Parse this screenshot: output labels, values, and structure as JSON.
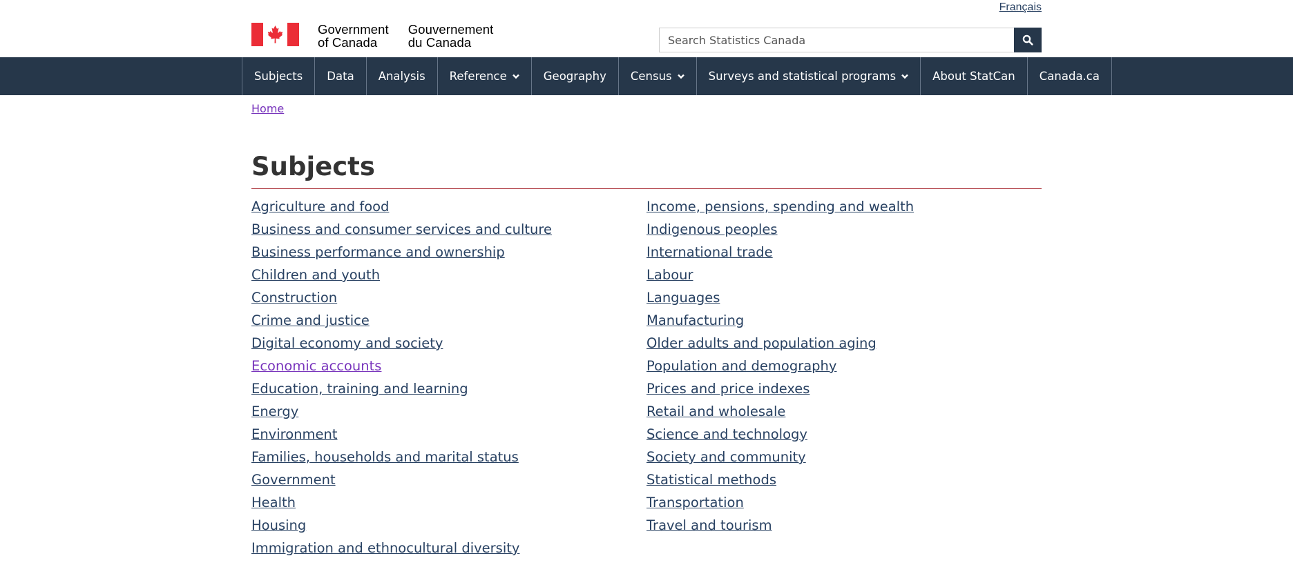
{
  "header": {
    "language_toggle": "Français",
    "signature_en_line1": "Government",
    "signature_en_line2": "of Canada",
    "signature_fr_line1": "Gouvernement",
    "signature_fr_line2": "du Canada",
    "search_placeholder": "Search Statistics Canada",
    "search_icon": "search-icon"
  },
  "nav": {
    "items": [
      {
        "label": "Subjects"
      },
      {
        "label": "Data"
      },
      {
        "label": "Analysis"
      },
      {
        "label": "Reference",
        "dropdown": true
      },
      {
        "label": "Geography"
      },
      {
        "label": "Census",
        "dropdown": true
      },
      {
        "label": "Surveys and statistical programs",
        "dropdown": true
      },
      {
        "label": "About StatCan"
      },
      {
        "label": "Canada.ca"
      }
    ]
  },
  "breadcrumb": {
    "home": "Home"
  },
  "main": {
    "title": "Subjects",
    "left_column": [
      "Agriculture and food",
      "Business and consumer services and culture",
      "Business performance and ownership",
      "Children and youth",
      "Construction",
      "Crime and justice",
      "Digital economy and society",
      "Economic accounts",
      "Education, training and learning",
      "Energy",
      "Environment",
      "Families, households and marital status",
      "Government",
      "Health",
      "Housing",
      "Immigration and ethnocultural diversity"
    ],
    "right_column": [
      "Income, pensions, spending and wealth",
      "Indigenous peoples",
      "International trade",
      "Labour",
      "Languages",
      "Manufacturing",
      "Older adults and population aging",
      "Population and demography",
      "Prices and price indexes",
      "Retail and wholesale",
      "Science and technology",
      "Society and community",
      "Statistical methods",
      "Transportation",
      "Travel and tourism"
    ]
  },
  "colors": {
    "nav_background": "#26374a",
    "link": "#284162",
    "visited_link": "#7834bc",
    "title_rule": "#af3c43",
    "flag_red": "#eb2d37"
  }
}
